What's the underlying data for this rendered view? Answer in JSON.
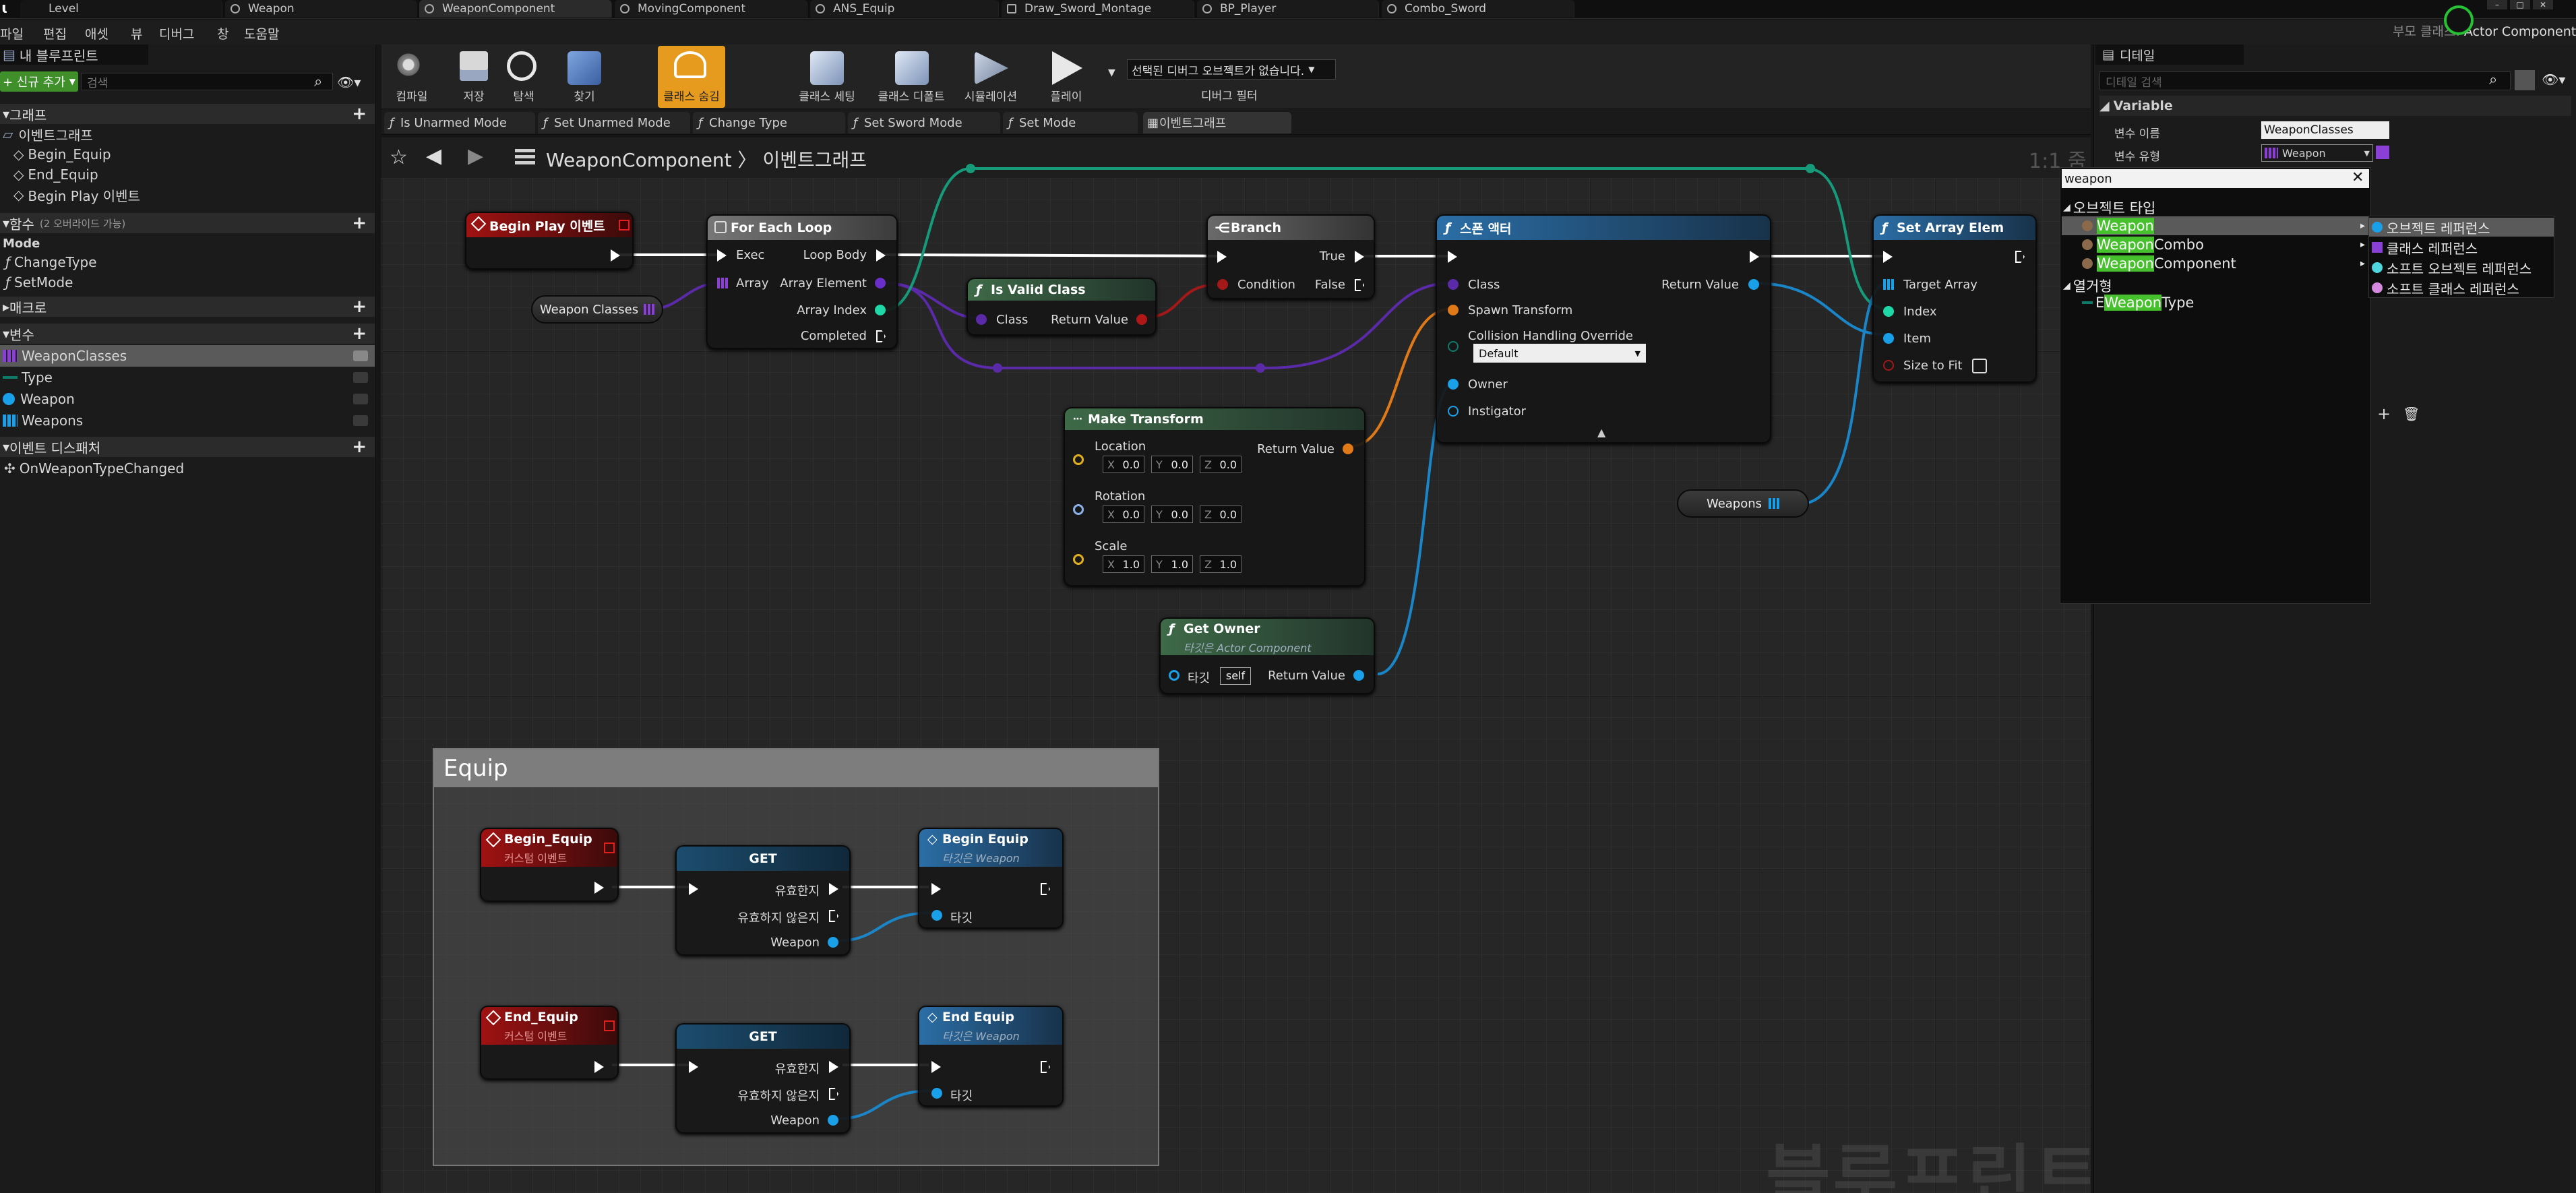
{
  "tabs": [
    "Level",
    "Weapon",
    "WeaponComponent",
    "MovingComponent",
    "ANS_Equip",
    "Draw_Sword_Montage",
    "BP_Player",
    "Combo_Sword"
  ],
  "parent_class": {
    "label": "부모 클래스:",
    "value": "Actor Component"
  },
  "menu": [
    "파일",
    "편집",
    "애셋",
    "뷰",
    "디버그",
    "창",
    "도움말"
  ],
  "left_panel": {
    "title": "내 블루프린트",
    "add_button": "+ 신규 추가",
    "search_placeholder": "검색",
    "graphs_header": "그래프",
    "event_graph": "이벤트그래프",
    "graph_items": [
      "Begin_Equip",
      "End_Equip",
      "Begin Play 이벤트"
    ],
    "functions_header": "함수",
    "functions_override": "(2 오버라이드 가능)",
    "function_category": "Mode",
    "functions": [
      "ChangeType",
      "SetMode"
    ],
    "macros_header": "매크로",
    "variables_header": "변수",
    "variables": [
      {
        "name": "WeaponClasses",
        "color": "#8a3fd6"
      },
      {
        "name": "Type",
        "color": "#0f7a6a"
      },
      {
        "name": "Weapon",
        "color": "#1aa0e8"
      },
      {
        "name": "Weapons",
        "color": "#1aa0e8"
      }
    ],
    "dispatchers_header": "이벤트 디스패처",
    "dispatchers": [
      "OnWeaponTypeChanged"
    ]
  },
  "toolbar": [
    {
      "label": "컴파일",
      "icon": "compile-icon"
    },
    {
      "label": "저장",
      "icon": "save-icon"
    },
    {
      "label": "탐색",
      "icon": "browse-icon"
    },
    {
      "label": "찾기",
      "icon": "find-icon"
    },
    {
      "label": "클래스 숨김",
      "icon": "hide-unrelated-icon"
    },
    {
      "label": "클래스 세팅",
      "icon": "class-settings-icon"
    },
    {
      "label": "클래스 디폴트",
      "icon": "class-defaults-icon"
    },
    {
      "label": "시뮬레이션",
      "icon": "simulation-icon"
    },
    {
      "label": "플레이",
      "icon": "play-icon"
    }
  ],
  "debug": {
    "select": "선택된 디버그 오브젝트가 없습니다.",
    "filter": "디버그 필터"
  },
  "graph_tabs": [
    "Is Unarmed Mode",
    "Set Unarmed Mode",
    "Change Type",
    "Set Sword Mode",
    "Set Mode",
    "이벤트그래프"
  ],
  "breadcrumb": {
    "root": "WeaponComponent",
    "sep": "〉",
    "current": "이벤트그래프",
    "zoom": "1:1 줌"
  },
  "nodes": {
    "begin_play": {
      "title": "Begin Play 이벤트"
    },
    "weapon_classes": {
      "label": "Weapon Classes"
    },
    "for_each": {
      "title": "For Each Loop",
      "exec": "Exec",
      "array": "Array",
      "loop_body": "Loop Body",
      "element": "Array Element",
      "index": "Array Index",
      "completed": "Completed"
    },
    "is_valid": {
      "title": "Is Valid Class",
      "class": "Class",
      "ret": "Return Value"
    },
    "branch": {
      "title": "Branch",
      "cond": "Condition",
      "t": "True",
      "f": "False"
    },
    "spawn": {
      "title": "스폰 액터",
      "class": "Class",
      "transform": "Spawn Transform",
      "collision": "Collision Handling Override",
      "collision_value": "Default",
      "owner": "Owner",
      "instigator": "Instigator",
      "ret": "Return Value"
    },
    "set_array": {
      "title": "Set Array Elem",
      "target": "Target Array",
      "index": "Index",
      "item": "Item",
      "size": "Size to Fit"
    },
    "make_transform": {
      "title": "Make Transform",
      "ret": "Return Value",
      "location": "Location",
      "rotation": "Rotation",
      "scale": "Scale",
      "loc": [
        "0.0",
        "0.0",
        "0.0"
      ],
      "rot": [
        "0.0",
        "0.0",
        "0.0"
      ],
      "scl": [
        "1.0",
        "1.0",
        "1.0"
      ],
      "axes": [
        "X",
        "Y",
        "Z"
      ]
    },
    "weapons_var": {
      "label": "Weapons"
    },
    "get_owner": {
      "title": "Get Owner",
      "subtitle": "타깃은 Actor Component",
      "target": "타깃",
      "self": "self",
      "ret": "Return Value"
    }
  },
  "comment": {
    "title": "Equip",
    "begin_equip_event": {
      "title": "Begin_Equip",
      "subtitle": "커스텀 이벤트"
    },
    "end_equip_event": {
      "title": "End_Equip",
      "subtitle": "커스텀 이벤트"
    },
    "get": {
      "title": "GET",
      "valid": "유효한지",
      "invalid": "유효하지 않은지",
      "weapon": "Weapon"
    },
    "begin_equip_call": {
      "title": "Begin Equip",
      "subtitle": "타깃은 Weapon",
      "target": "타깃"
    },
    "end_equip_call": {
      "title": "End Equip",
      "subtitle": "타깃은 Weapon",
      "target": "타깃"
    }
  },
  "watermark": "블루프린트",
  "details": {
    "tab": "디테일",
    "search_placeholder": "디테일 검색",
    "category": "Variable",
    "var_name_label": "변수 이름",
    "var_name": "WeaponClasses",
    "var_type_label": "변수 유형",
    "var_type": "Weapon"
  },
  "type_picker": {
    "search": "weapon",
    "object_types": "오브젝트 타입",
    "items": [
      {
        "hl": "Weapon",
        "rest": ""
      },
      {
        "hl": "Weapon",
        "rest": " Combo"
      },
      {
        "hl": "Weapon",
        "rest": " Component"
      }
    ],
    "enums": "열거형",
    "enum_prefix": "E",
    "enum_hl": "Weapon",
    "enum_rest": " Type",
    "submenu": [
      {
        "label": "오브젝트 레퍼런스",
        "color": "#1aa0e8"
      },
      {
        "label": "클래스 레퍼런스",
        "color": "#8a3fd6"
      },
      {
        "label": "소프트 오브젝트 레퍼런스",
        "color": "#4fd7e0"
      },
      {
        "label": "소프트 클래스 레퍼런스",
        "color": "#d68adf"
      }
    ]
  },
  "colors": {
    "exec": "#ffffff",
    "object": "#1aa0e8",
    "class": "#5a2aa8",
    "int": "#1fd8a8",
    "bool": "#c01a1a",
    "struct": "#f08020",
    "accent": "#f0a030"
  }
}
